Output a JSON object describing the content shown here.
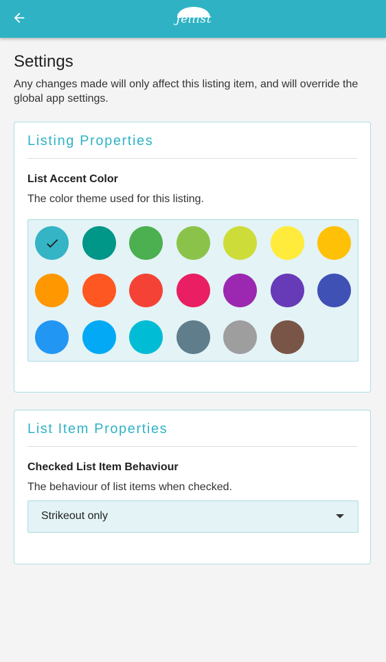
{
  "app_bar": {
    "logo_text": "Jellist",
    "color": "#2fb3c4"
  },
  "page": {
    "title": "Settings",
    "description": "Any changes made will only affect this listing item, and will override the global app settings."
  },
  "listing_properties": {
    "title": "Listing Properties",
    "accent_color_label": "List Accent Color",
    "accent_color_description": "The color theme used for this listing.",
    "selected_index": 0,
    "swatches": [
      "#35b4c6",
      "#009688",
      "#4caf50",
      "#8bc34a",
      "#cddc39",
      "#ffeb3b",
      "#ffc107",
      "#ff9800",
      "#ff5722",
      "#f44336",
      "#e91e63",
      "#9c27b0",
      "#673ab7",
      "#3f51b5",
      "#2196f3",
      "#03a9f4",
      "#00bcd4",
      "#607d8b",
      "#9e9e9e",
      "#795548"
    ]
  },
  "list_item_properties": {
    "title": "List Item Properties",
    "checked_behaviour_label": "Checked List Item Behaviour",
    "checked_behaviour_description": "The behaviour of list items when checked.",
    "checked_behaviour_value": "Strikeout only"
  }
}
